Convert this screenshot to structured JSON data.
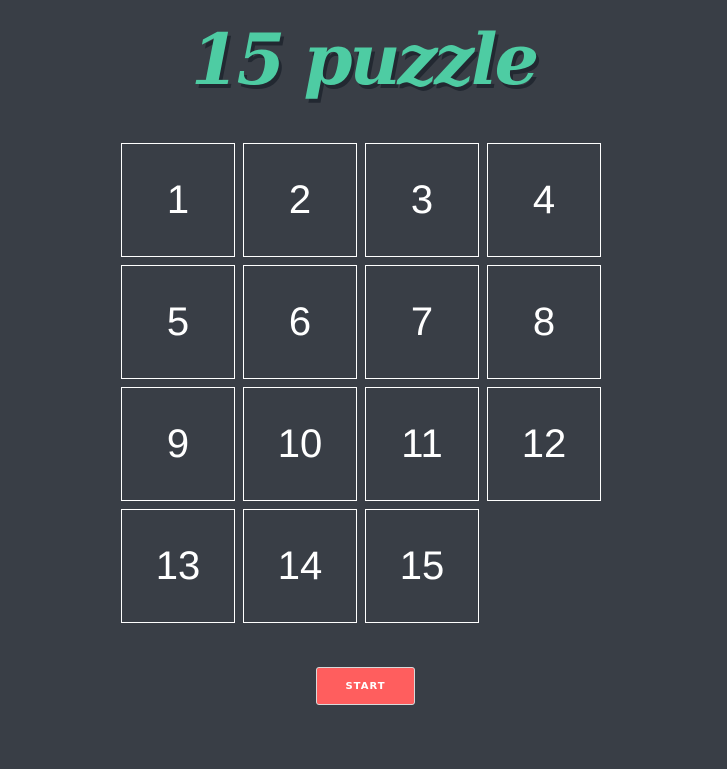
{
  "header": {
    "title": "15 puzzle"
  },
  "board": {
    "rows": 4,
    "cols": 4,
    "tiles": [
      "1",
      "2",
      "3",
      "4",
      "5",
      "6",
      "7",
      "8",
      "9",
      "10",
      "11",
      "12",
      "13",
      "14",
      "15",
      ""
    ]
  },
  "controls": {
    "start_label": "START"
  },
  "colors": {
    "background": "#393e46",
    "title": "#4ecca3",
    "title_shadow": "#222831",
    "tile_border": "#ffffff",
    "tile_text": "#ffffff",
    "start_button": "#ff5e5e"
  }
}
